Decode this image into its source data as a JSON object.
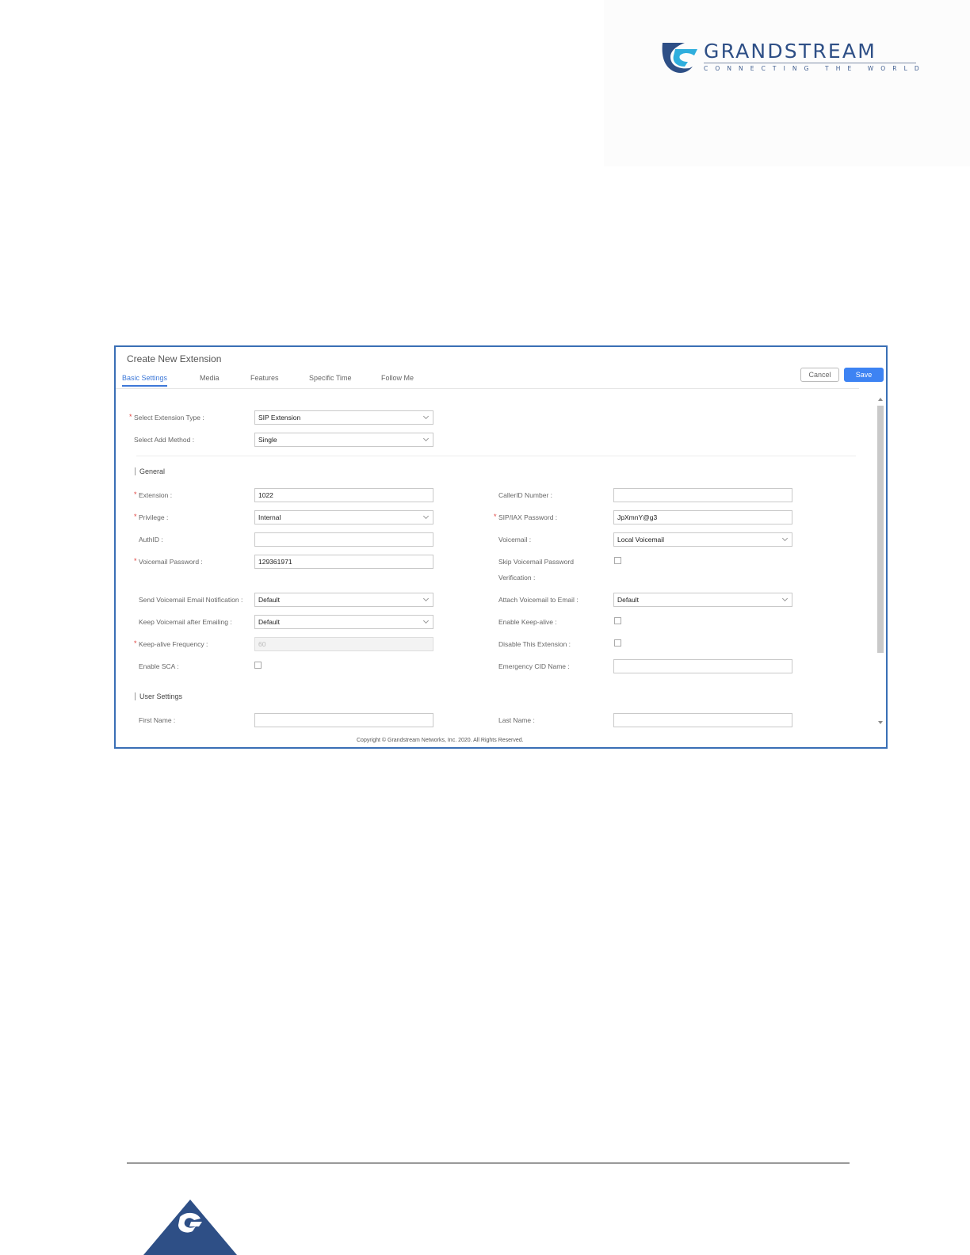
{
  "brand": {
    "name": "GRANDSTREAM",
    "tagline": "CONNECTING THE WORLD",
    "color": "#2e4f86"
  },
  "dialog": {
    "title": "Create New Extension",
    "tabs": [
      {
        "label": "Basic Settings",
        "active": true
      },
      {
        "label": "Media",
        "active": false
      },
      {
        "label": "Features",
        "active": false
      },
      {
        "label": "Specific Time",
        "active": false
      },
      {
        "label": "Follow Me",
        "active": false
      }
    ],
    "cancel_label": "Cancel",
    "save_label": "Save",
    "accent_color": "#3d83f3"
  },
  "form": {
    "extension_type": {
      "label": "Select Extension Type :",
      "value": "SIP Extension",
      "required": true
    },
    "add_method": {
      "label": "Select Add Method :",
      "value": "Single"
    },
    "general_title": "General",
    "extension": {
      "label": "Extension :",
      "value": "1022",
      "required": true
    },
    "callerid_number": {
      "label": "CallerID Number :",
      "value": ""
    },
    "privilege": {
      "label": "Privilege :",
      "value": "Internal",
      "required": true
    },
    "sip_iax_password": {
      "label": "SIP/IAX Password :",
      "value": "JpXmnY@g3",
      "required": true
    },
    "authid": {
      "label": "AuthID :",
      "value": ""
    },
    "voicemail": {
      "label": "Voicemail :",
      "value": "Local Voicemail"
    },
    "voicemail_password": {
      "label": "Voicemail Password :",
      "value": "129361971",
      "required": true
    },
    "skip_voicemail_password": {
      "label_line1": "Skip Voicemail Password",
      "label_line2": "Verification :",
      "checked": false
    },
    "send_voicemail_email": {
      "label": "Send Voicemail Email Notification :",
      "value": "Default"
    },
    "attach_voicemail_email": {
      "label": "Attach Voicemail to Email :",
      "value": "Default"
    },
    "keep_voicemail": {
      "label": "Keep Voicemail after Emailing :",
      "value": "Default"
    },
    "enable_keepalive": {
      "label": "Enable Keep-alive :",
      "checked": false
    },
    "keepalive_frequency": {
      "label": "Keep-alive Frequency :",
      "value": "60",
      "required": true,
      "disabled": true
    },
    "disable_extension": {
      "label": "Disable This Extension :",
      "checked": false
    },
    "enable_sca": {
      "label": "Enable SCA :",
      "checked": false
    },
    "emergency_cid_name": {
      "label": "Emergency CID Name :",
      "value": ""
    },
    "user_settings_title": "User Settings",
    "first_name": {
      "label": "First Name :",
      "value": ""
    },
    "last_name": {
      "label": "Last Name :",
      "value": ""
    }
  },
  "copyright": "Copyright © Grandstream Networks, Inc. 2020. All Rights Reserved."
}
